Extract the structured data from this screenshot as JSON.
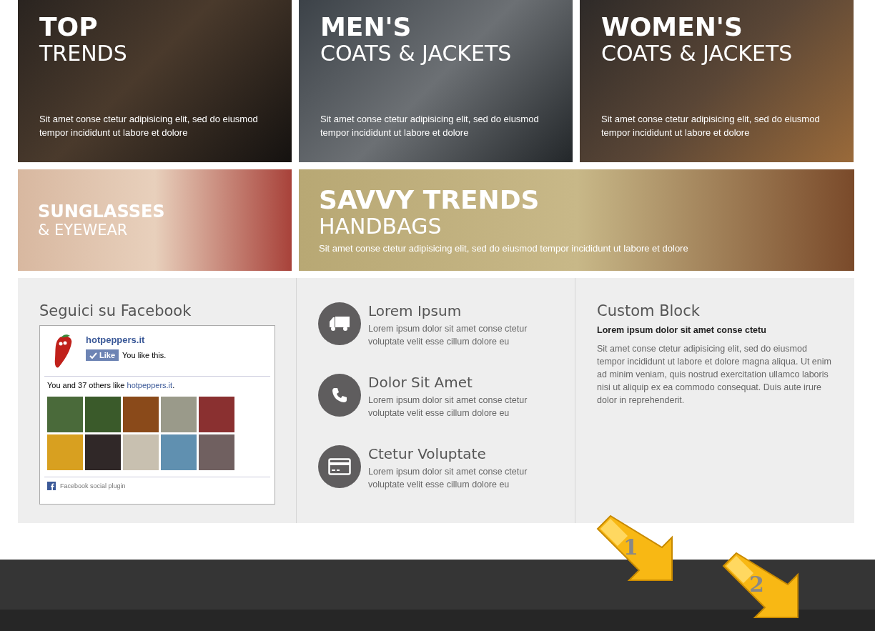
{
  "banners_top": [
    {
      "kind": "night",
      "title": "TOP",
      "subtitle": "TRENDS",
      "text": "Sit amet conse ctetur adipisicing elit, sed do eiusmod tempor incididunt ut labore et dolore"
    },
    {
      "kind": "slate",
      "title": "MEN'S",
      "subtitle": "COATS & JACKETS",
      "text": "Sit amet conse ctetur adipisicing elit, sed do eiusmod tempor incididunt ut labore et dolore"
    },
    {
      "kind": "warm",
      "title": "WOMEN'S",
      "subtitle": "COATS & JACKETS",
      "text": "Sit amet conse ctetur adipisicing elit, sed do eiusmod tempor incididunt ut labore et dolore"
    }
  ],
  "banners_bottom": [
    {
      "kind": "peach",
      "title": "SUNGLASSES",
      "subtitle": "& EYEWEAR"
    },
    {
      "kind": "sand",
      "title": "SAVVY TRENDS",
      "subtitle": "HANDBAGS",
      "text": "Sit amet conse ctetur adipisicing elit, sed do eiusmod tempor incididunt ut labore et dolore"
    }
  ],
  "facebook": {
    "heading": "Seguici su Facebook",
    "page_name": "hotpeppers.it",
    "like_button": "Like",
    "like_status": "You like this.",
    "friends_before": "You and 37 others like ",
    "friends_link": "hotpeppers.it",
    "friends_after": ".",
    "plugin_label": "Facebook social plugin"
  },
  "features": [
    {
      "kind": "truck",
      "title": "Lorem Ipsum",
      "text": "Lorem ipsum dolor sit amet conse ctetur voluptate velit esse cillum dolore eu"
    },
    {
      "kind": "phone",
      "title": "Dolor Sit Amet",
      "text": "Lorem ipsum dolor sit amet conse ctetur voluptate velit esse cillum dolore eu"
    },
    {
      "kind": "card",
      "title": "Ctetur Voluptate",
      "text": "Lorem ipsum dolor sit amet conse ctetur voluptate velit esse cillum dolore eu"
    }
  ],
  "custom_block": {
    "heading": "Custom Block",
    "lead": "Lorem ipsum dolor sit amet conse ctetu",
    "text": "Sit amet conse ctetur adipisicing elit, sed do eiusmod tempor incididunt ut labore et dolore magna aliqua. Ut enim ad minim veniam, quis nostrud exercitation ullamco laboris nisi ut aliquip ex ea commodo consequat. Duis aute irure dolor in reprehenderit."
  },
  "annotations": [
    {
      "label": "1"
    },
    {
      "label": "2"
    }
  ]
}
